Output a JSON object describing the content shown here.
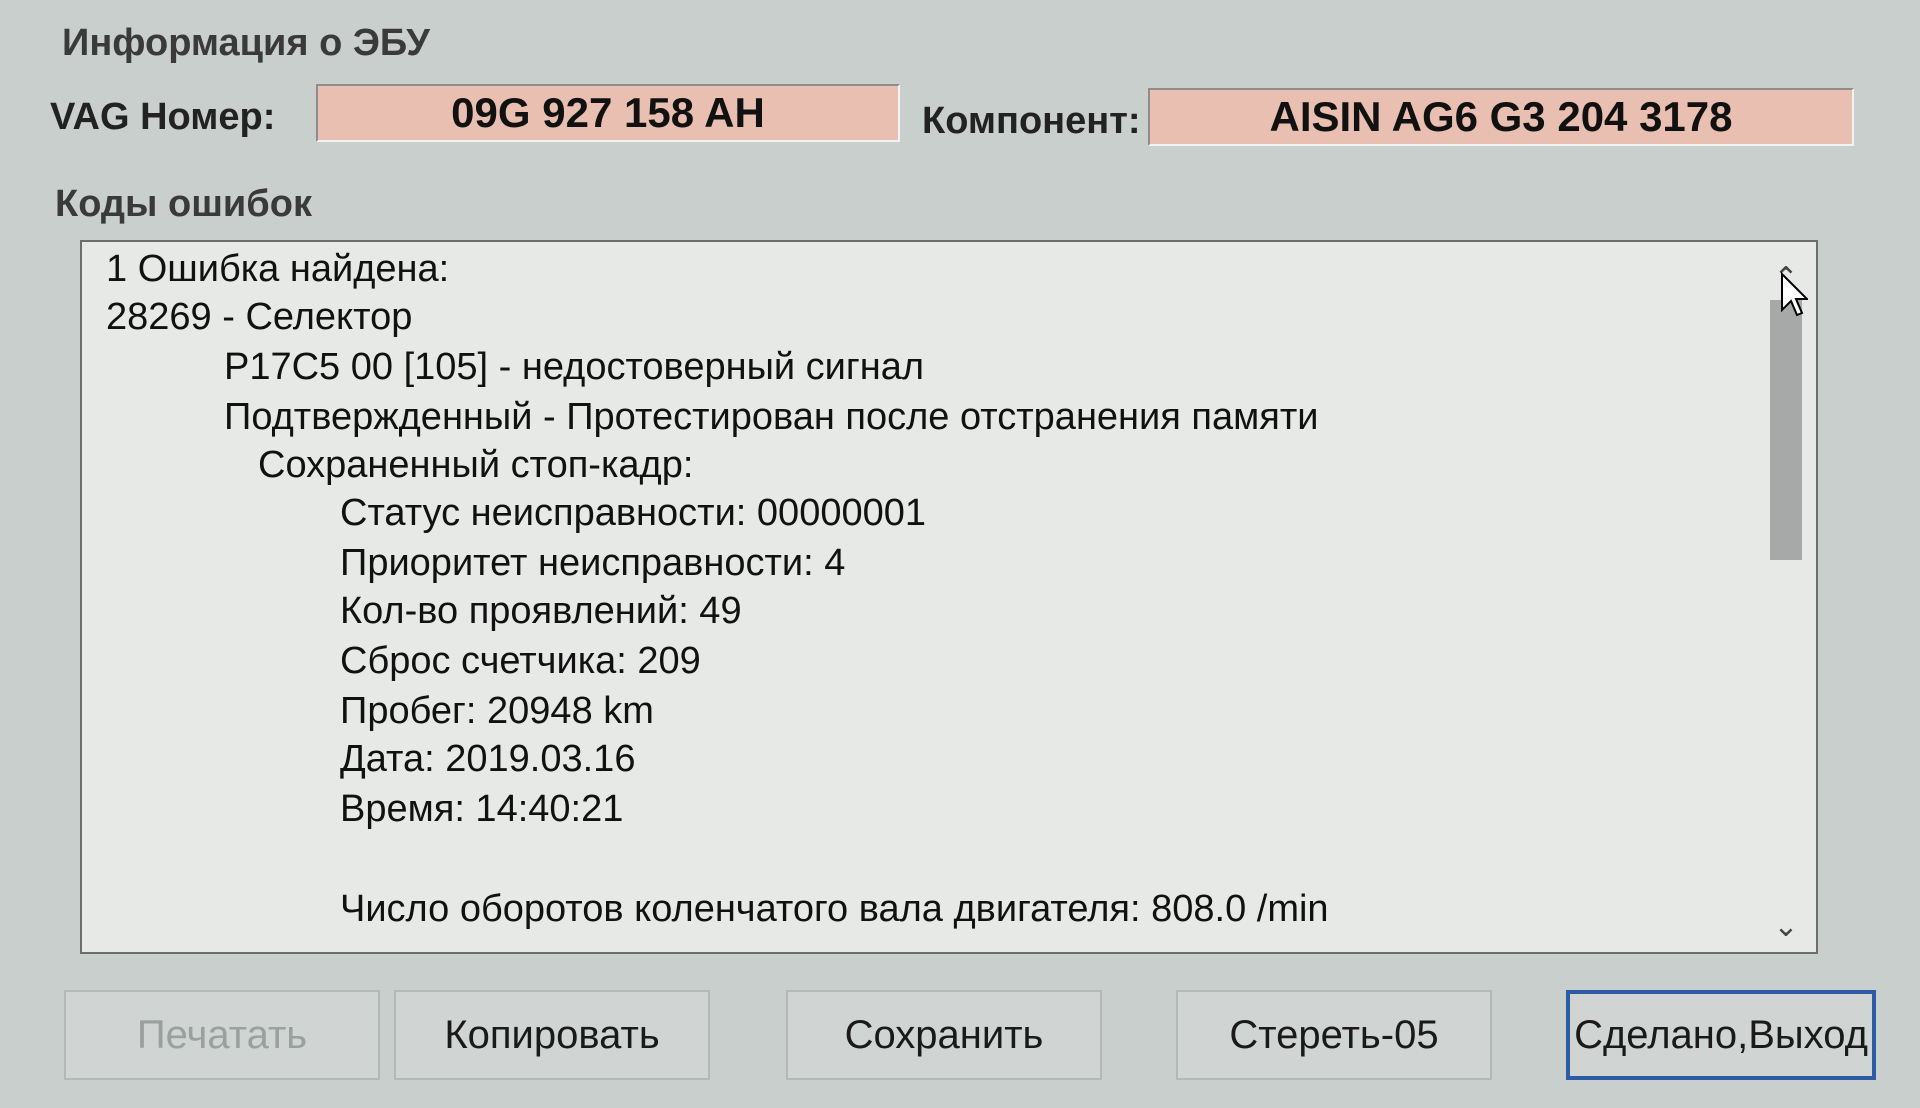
{
  "ecu_info": {
    "section_title": "Информация о ЭБУ",
    "vag_label": "VAG Номер:",
    "vag_number": "09G 927 158 AH",
    "component_label": "Компонент:",
    "component": "AISIN AG6 G3  204 3178"
  },
  "fault_codes": {
    "section_title": "Коды ошибок",
    "lines": [
      "1 Ошибка найдена:",
      "28269 - Селектор",
      "P17C5 00 [105] - недостоверный сигнал",
      "Подтвержденный - Протестирован после отстранения памяти",
      "Сохраненный стоп-кадр:",
      "Статус неисправности: 00000001",
      "Приоритет неисправности: 4",
      "Кол-во проявлений: 49",
      "Сброс счетчика: 209",
      "Пробег: 20948 km",
      "Дата: 2019.03.16",
      "Время: 14:40:21",
      "Число оборотов коленчатого вала двигателя: 808.0 /min"
    ]
  },
  "buttons": {
    "print": "Печатать",
    "copy": "Копировать",
    "save": "Сохранить",
    "erase": "Стереть-05",
    "done": "Сделано,Выход"
  },
  "icons": {
    "scroll_up": "chevron-up-icon",
    "scroll_down": "chevron-down-icon",
    "cursor": "mouse-pointer-icon"
  },
  "colors": {
    "value_box_bg": "#e8bfb0",
    "default_button_border": "#2d5ca6"
  }
}
